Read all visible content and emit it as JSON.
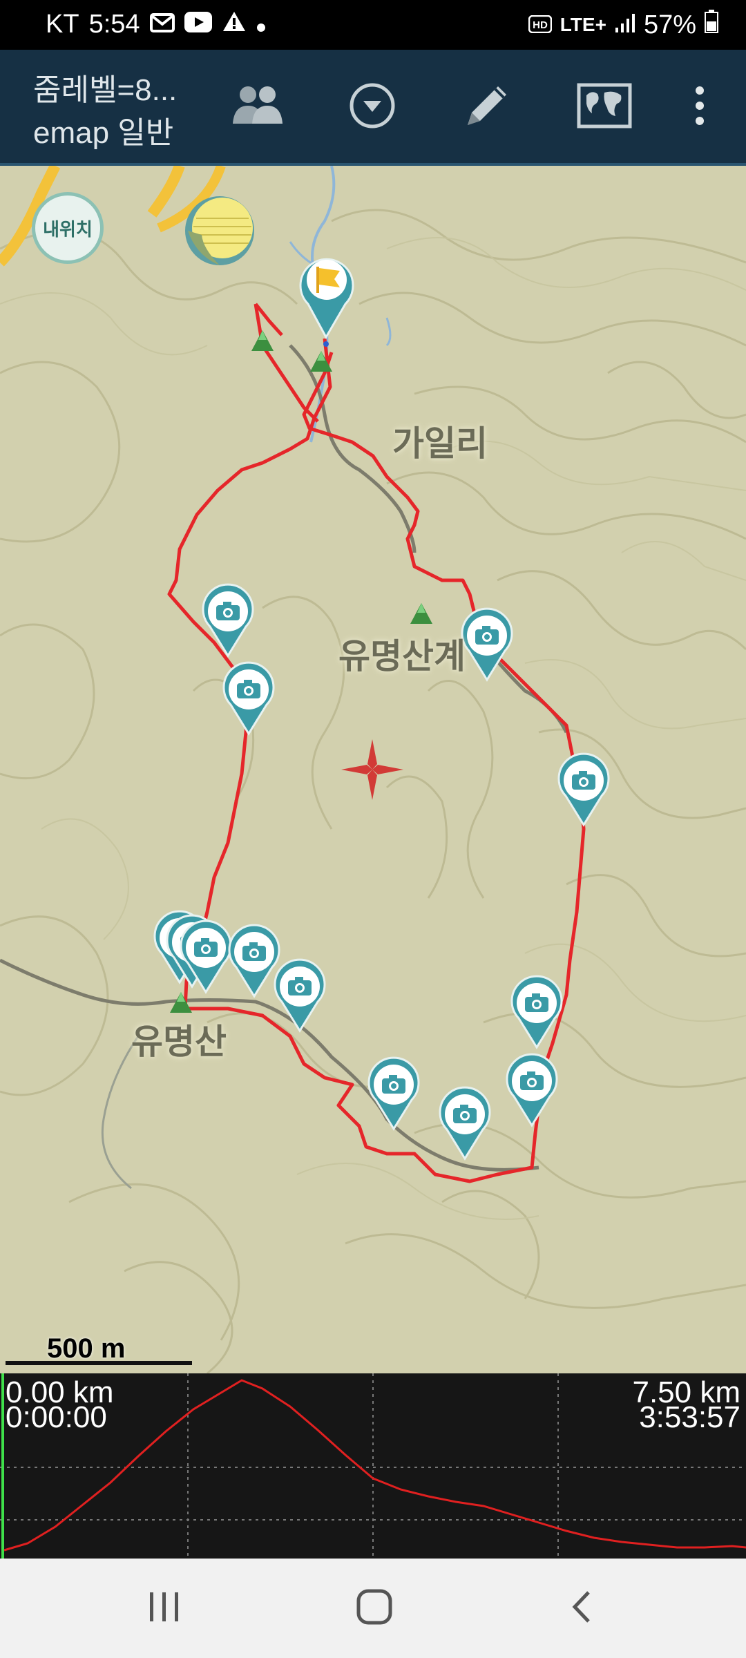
{
  "status_bar": {
    "carrier": "KT",
    "time": "5:54",
    "network": "LTE+",
    "battery": "57%"
  },
  "toolbar": {
    "title_line1": "줌레벨=8...",
    "title_line2": "emap 일반",
    "icons": [
      "group-icon",
      "dropdown-icon",
      "pencil-icon",
      "map-icon",
      "more-icon"
    ]
  },
  "map": {
    "my_location_label": "내위치",
    "place_labels": [
      "가일리",
      "유명산계",
      "유명산"
    ],
    "scale_label": "500 m"
  },
  "elevation_profile": {
    "start_distance": "0.00 km",
    "start_time": "0:00:00",
    "end_distance": "7.50 km",
    "end_time": "3:53:57"
  },
  "colors": {
    "toolbar_bg": "#163044",
    "track": "#e5262a",
    "marker": "#3a9aa6",
    "map_bg": "#d2d0ae"
  }
}
